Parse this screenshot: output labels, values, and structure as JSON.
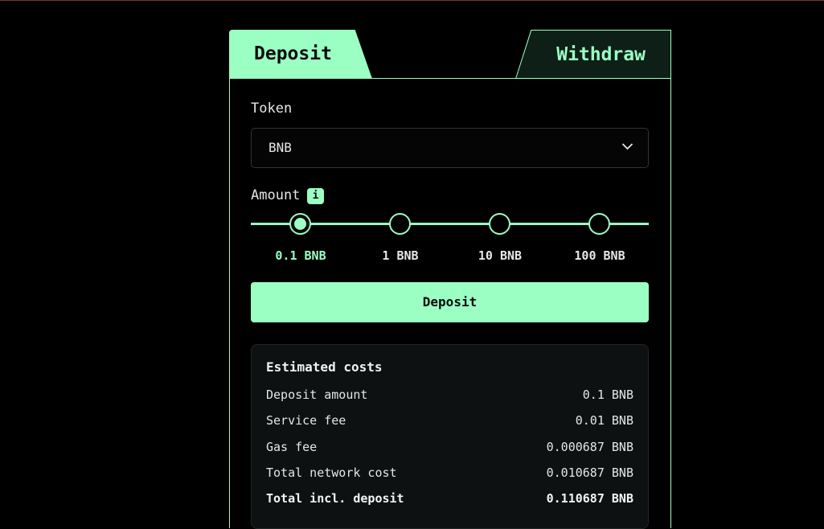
{
  "tabs": {
    "deposit": "Deposit",
    "withdraw": "Withdraw"
  },
  "token": {
    "label": "Token",
    "selected": "BNB"
  },
  "amount": {
    "label": "Amount",
    "info": "i",
    "options": [
      "0.1 BNB",
      "1 BNB",
      "10 BNB",
      "100 BNB"
    ],
    "selected_index": 0
  },
  "action": {
    "deposit_label": "Deposit"
  },
  "costs": {
    "title": "Estimated costs",
    "rows": [
      {
        "label": "Deposit amount",
        "value": "0.1 BNB"
      },
      {
        "label": "Service fee",
        "value": "0.01 BNB"
      },
      {
        "label": "Gas fee",
        "value": "0.000687 BNB"
      },
      {
        "label": "Total network cost",
        "value": "0.010687 BNB"
      },
      {
        "label": "Total incl. deposit",
        "value": "0.110687 BNB"
      }
    ]
  },
  "colors": {
    "accent": "#9bffc4",
    "background": "#000000",
    "panel": "#0e1111"
  },
  "icons": {
    "select": "chevron-down-icon"
  }
}
